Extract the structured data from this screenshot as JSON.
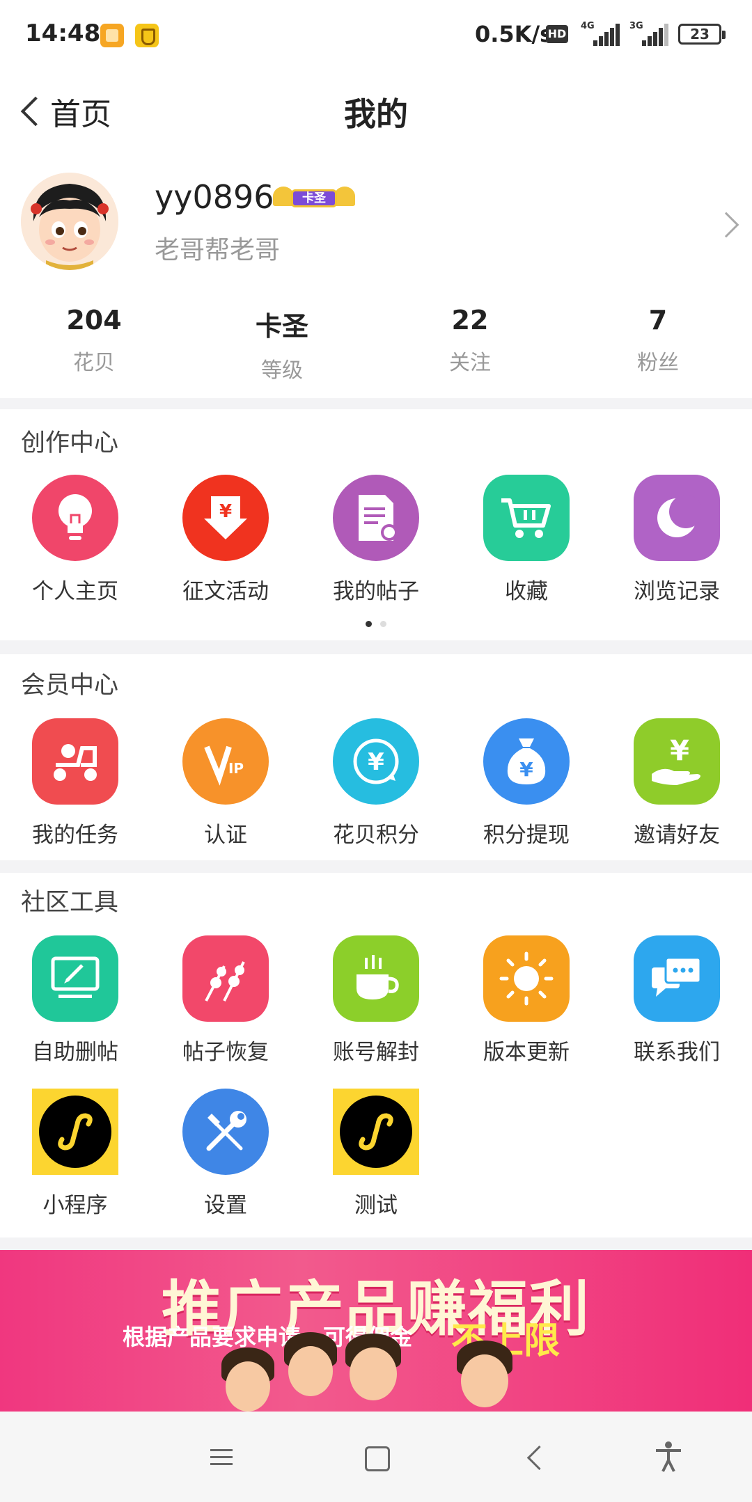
{
  "status_bar": {
    "time": "14:48",
    "net_speed": "0.5K/s",
    "hd": "HD",
    "signal1": "4G",
    "signal2": "3G",
    "battery": "23"
  },
  "header": {
    "back_label": "首页",
    "title": "我的"
  },
  "profile": {
    "username": "yy0896",
    "rank_badge": "卡圣",
    "signature": "老哥帮老哥",
    "stats": [
      {
        "value": "204",
        "label": "花贝"
      },
      {
        "value": "卡圣",
        "label": "等级"
      },
      {
        "value": "22",
        "label": "关注"
      },
      {
        "value": "7",
        "label": "粉丝"
      }
    ]
  },
  "creation": {
    "title": "创作中心",
    "items": [
      {
        "label": "个人主页",
        "icon": "lightbulb-icon",
        "color": "#f0466a"
      },
      {
        "label": "征文活动",
        "icon": "yuan-download-icon",
        "color": "#f0331f"
      },
      {
        "label": "我的帖子",
        "icon": "document-icon",
        "color": "#b05ab8"
      },
      {
        "label": "收藏",
        "icon": "cart-icon",
        "color": "#27cc98"
      },
      {
        "label": "浏览记录",
        "icon": "moon-icon",
        "color": "#b063c6"
      }
    ]
  },
  "member": {
    "title": "会员中心",
    "items": [
      {
        "label": "我的任务",
        "icon": "scooter-icon",
        "color": "#f04c50"
      },
      {
        "label": "认证",
        "icon": "vip-icon",
        "color": "#f7922a"
      },
      {
        "label": "花贝积分",
        "icon": "yuan-refresh-icon",
        "color": "#26bde0"
      },
      {
        "label": "积分提现",
        "icon": "money-bag-icon",
        "color": "#3a8ff0"
      },
      {
        "label": "邀请好友",
        "icon": "yuan-hand-icon",
        "color": "#8fcc2a"
      }
    ]
  },
  "tools": {
    "title": "社区工具",
    "items": [
      {
        "label": "自助删帖",
        "icon": "monitor-edit-icon",
        "color": "#20c799"
      },
      {
        "label": "帖子恢复",
        "icon": "skewers-icon",
        "color": "#f2486a"
      },
      {
        "label": "账号解封",
        "icon": "coffee-cup-icon",
        "color": "#8ccf2a"
      },
      {
        "label": "版本更新",
        "icon": "sun-icon",
        "color": "#f7a11e"
      },
      {
        "label": "联系我们",
        "icon": "chat-bubbles-icon",
        "color": "#2da7ee"
      },
      {
        "label": "小程序",
        "icon": "mini-program-icon",
        "color": "#000000"
      },
      {
        "label": "设置",
        "icon": "wrench-screwdriver-icon",
        "color": "#3f86e6"
      },
      {
        "label": "测试",
        "icon": "mini-program-icon",
        "color": "#000000"
      }
    ]
  },
  "banner": {
    "title": "推广产品赚福利",
    "subtitle": "根据产品要求申请，可得佣金",
    "highlight": "不上限"
  }
}
